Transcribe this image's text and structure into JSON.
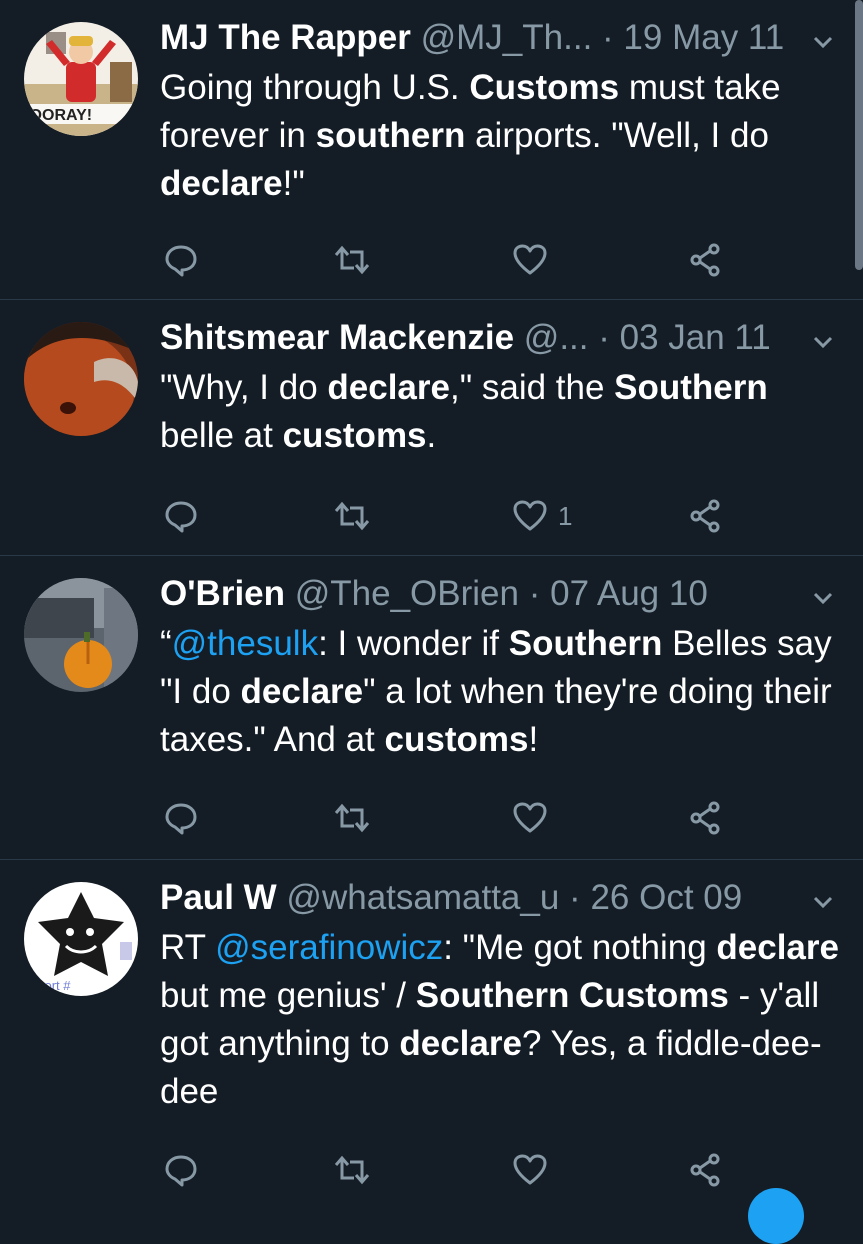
{
  "tweets": [
    {
      "name": "MJ The Rapper",
      "handle": "@MJ_Th...",
      "date": "19 May 11",
      "avatar_text": "HOORAY!",
      "body": [
        {
          "t": "Going through U.S. "
        },
        {
          "t": "Customs",
          "b": true
        },
        {
          "t": " must take forever in "
        },
        {
          "t": "southern",
          "b": true
        },
        {
          "t": " airports. \"Well, I do "
        },
        {
          "t": "declare",
          "b": true
        },
        {
          "t": "!\""
        }
      ],
      "likes": ""
    },
    {
      "name": "Shitsmear Mackenzie",
      "handle": "@...",
      "date": "03 Jan 11",
      "body": [
        {
          "t": "\"Why, I do "
        },
        {
          "t": "declare",
          "b": true
        },
        {
          "t": ",\" said the "
        },
        {
          "t": "Southern",
          "b": true
        },
        {
          "t": " belle at "
        },
        {
          "t": "customs",
          "b": true
        },
        {
          "t": "."
        }
      ],
      "likes": "1"
    },
    {
      "name": "O'Brien",
      "handle": "@The_OBrien",
      "date": "07 Aug 10",
      "body": [
        {
          "t": "“"
        },
        {
          "t": "@thesulk",
          "link": true
        },
        {
          "t": ": I wonder if "
        },
        {
          "t": "Southern",
          "b": true
        },
        {
          "t": " Belles say \"I do "
        },
        {
          "t": "declare",
          "b": true
        },
        {
          "t": "\" a lot when they're doing their taxes.\" And at "
        },
        {
          "t": "customs",
          "b": true
        },
        {
          "t": "!"
        }
      ],
      "likes": ""
    },
    {
      "name": "Paul W",
      "handle": "@whatsamatta_u",
      "date": "26 Oct 09",
      "avatar_text": "pport #",
      "body": [
        {
          "t": "RT "
        },
        {
          "t": "@serafinowicz",
          "link": true
        },
        {
          "t": ": \"Me got nothing "
        },
        {
          "t": "declare",
          "b": true
        },
        {
          "t": " but me genius' / "
        },
        {
          "t": "Southern Customs",
          "b": true
        },
        {
          "t": " - y'all got anything to "
        },
        {
          "t": "declare",
          "b": true
        },
        {
          "t": "? Yes, a fiddle-dee-dee"
        }
      ],
      "likes": ""
    }
  ],
  "icons": {
    "reply": "reply-icon",
    "retweet": "retweet-icon",
    "like": "heart-icon",
    "share": "share-icon",
    "menu": "chevron-down-icon"
  },
  "colors": {
    "background": "#141d26",
    "secondary_text": "#8899a6",
    "link": "#1da1f2",
    "divider": "#2b3845"
  }
}
